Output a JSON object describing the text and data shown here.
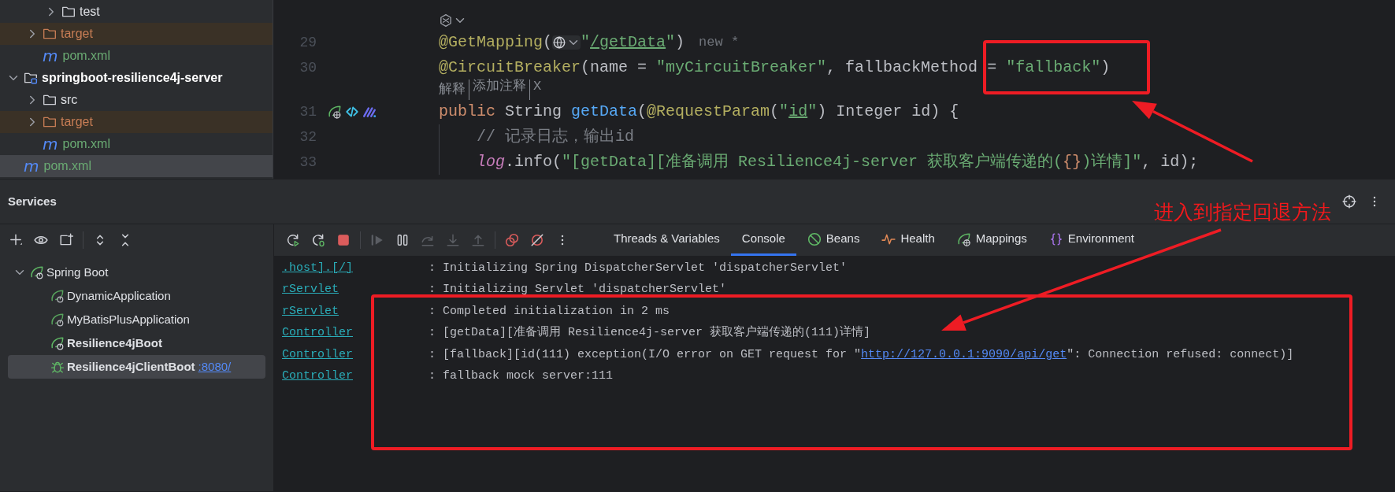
{
  "project_tree": [
    {
      "children": [
        {
          "children": [
            {
              "label": "test",
              "kind": "folder",
              "expanded": false,
              "selected": false
            }
          ]
        },
        {
          "label": "target",
          "kind": "excluded-folder",
          "expanded": false,
          "selected": false
        },
        {
          "label": "pom.xml",
          "kind": "maven",
          "icon_text": "m",
          "selected": false
        }
      ]
    },
    {
      "label": "springboot-resilience4j-server",
      "kind": "module",
      "expanded": true,
      "selected": false,
      "children": [
        {
          "label": "src",
          "kind": "folder",
          "expanded": false,
          "selected": false
        },
        {
          "label": "target",
          "kind": "excluded-folder",
          "expanded": false,
          "selected": false
        },
        {
          "label": "pom.xml",
          "kind": "maven",
          "icon_text": "m",
          "selected": false
        }
      ]
    },
    {
      "label": "pom.xml",
      "kind": "maven",
      "icon_text": "m",
      "selected": true
    }
  ],
  "editor": {
    "lines": [
      {
        "kind": "inlay"
      },
      {
        "kind": "code",
        "number": "29",
        "hint": "new *",
        "tokens": [
          {
            "kind": "annotation",
            "text": "@GetMapping"
          },
          {
            "kind": "plain",
            "text": "("
          },
          {
            "kind": "globe-inlay"
          },
          {
            "kind": "string",
            "text": "\""
          },
          {
            "kind": "link-string",
            "text": "/getData"
          },
          {
            "kind": "string",
            "text": "\""
          },
          {
            "kind": "plain",
            "text": ")"
          }
        ]
      },
      {
        "kind": "code",
        "number": "30",
        "tokens": [
          {
            "kind": "annotation",
            "text": "@CircuitBreaker"
          },
          {
            "kind": "plain",
            "text": "(name = "
          },
          {
            "kind": "string",
            "text": "\"myCircuitBreaker\""
          },
          {
            "kind": "plain",
            "text": ", fallbackMethod = "
          },
          {
            "kind": "string",
            "text": "\"fallback\""
          },
          {
            "kind": "plain",
            "text": ")"
          }
        ]
      },
      {
        "kind": "actions",
        "actions": [
          "解释",
          "添加注释",
          "X"
        ]
      },
      {
        "kind": "code",
        "number": "31",
        "gutter_icons": [
          {
            "kind": "endpoint"
          },
          {
            "kind": "navigate"
          },
          {
            "kind": "ai"
          }
        ],
        "tokens": [
          {
            "kind": "keyword",
            "text": "public "
          },
          {
            "kind": "plain",
            "text": "String "
          },
          {
            "kind": "method",
            "text": "getData"
          },
          {
            "kind": "plain",
            "text": "("
          },
          {
            "kind": "annotation",
            "text": "@RequestParam"
          },
          {
            "kind": "plain",
            "text": "("
          },
          {
            "kind": "string",
            "text": "\""
          },
          {
            "kind": "link-string",
            "text": "id"
          },
          {
            "kind": "string",
            "text": "\""
          },
          {
            "kind": "plain",
            "text": ") Integer id) {"
          }
        ]
      },
      {
        "kind": "code",
        "number": "32",
        "indented": true,
        "tokens": [
          {
            "kind": "comment",
            "text": "// 记录日志，输出id"
          }
        ]
      },
      {
        "kind": "code",
        "number": "33",
        "indented": true,
        "tokens": [
          {
            "kind": "field",
            "text": "log"
          },
          {
            "kind": "plain",
            "text": ".info("
          },
          {
            "kind": "string",
            "text": "\"[getData][准备调用 Resilience4j-server 获取客户端传递的("
          },
          {
            "kind": "placeholder",
            "text": "{}"
          },
          {
            "kind": "string",
            "text": ")详情]\""
          },
          {
            "kind": "plain",
            "text": ", id);"
          }
        ]
      }
    ]
  },
  "services": {
    "title": "Services",
    "header_icons": [
      {
        "kind": "crosshair"
      },
      {
        "kind": "more"
      }
    ],
    "toolbar": [
      {
        "kind": "add"
      },
      {
        "kind": "eye"
      },
      {
        "kind": "new-group"
      },
      {
        "kind": "separator"
      },
      {
        "kind": "expand"
      },
      {
        "kind": "collapse"
      }
    ],
    "tree": [
      {
        "label": "Spring Boot",
        "kind": "group",
        "expanded": true,
        "selected": false,
        "children": [
          {
            "label": "DynamicApplication",
            "kind": "app",
            "running": false,
            "selected": false
          },
          {
            "label": "MyBatisPlusApplication",
            "kind": "app",
            "running": false,
            "selected": false
          },
          {
            "label": "Resilience4jBoot",
            "kind": "app",
            "running": true,
            "selected": false
          },
          {
            "label": "Resilience4jClientBoot",
            "kind": "debug",
            "running": true,
            "selected": true,
            "port": ":8080/"
          }
        ]
      }
    ],
    "run_toolbar": [
      {
        "kind": "rerun",
        "disabled": false
      },
      {
        "kind": "rerun-debug",
        "disabled": false
      },
      {
        "kind": "stop",
        "disabled": false
      },
      {
        "kind": "separator"
      },
      {
        "kind": "resume",
        "disabled": true
      },
      {
        "kind": "pause",
        "disabled": false
      },
      {
        "kind": "step-over",
        "disabled": true
      },
      {
        "kind": "step-into",
        "disabled": true
      },
      {
        "kind": "step-out",
        "disabled": true
      },
      {
        "kind": "separator"
      },
      {
        "kind": "breakpoints",
        "disabled": false
      },
      {
        "kind": "mute-breakpoints",
        "disabled": false
      },
      {
        "kind": "more",
        "disabled": false
      }
    ],
    "tabs": [
      {
        "label": "Threads & Variables",
        "kind": "plain",
        "selected": false
      },
      {
        "label": "Console",
        "kind": "plain",
        "selected": true
      },
      {
        "label": "Beans",
        "kind": "beans",
        "selected": false
      },
      {
        "label": "Health",
        "kind": "health",
        "selected": false
      },
      {
        "label": "Mappings",
        "kind": "mappings",
        "selected": false
      },
      {
        "label": "Environment",
        "kind": "environment",
        "selected": false
      }
    ],
    "console": [
      {
        "source": ".host].[/]",
        "message": ": Initializing Spring DispatcherServlet 'dispatcherServlet'"
      },
      {
        "source": "rServlet",
        "message": ": Initializing Servlet 'dispatcherServlet'"
      },
      {
        "source": "rServlet",
        "message": ": Completed initialization in 2 ms"
      },
      {
        "source": "Controller",
        "message": ": [getData][准备调用 Resilience4j-server 获取客户端传递的(111)详情]"
      },
      {
        "source": "Controller",
        "message": ": [fallback][id(111) exception(I/O error on GET request for \"",
        "link": "http://127.0.0.1:9090/api/get",
        "message_after": "\": Connection refused: connect)]"
      },
      {
        "source": "Controller",
        "message": ": fallback mock server:111"
      }
    ]
  },
  "annotations": [
    {
      "kind": "box"
    },
    {
      "kind": "arrow"
    },
    {
      "kind": "label",
      "text": "进入到指定回退方法"
    },
    {
      "kind": "arrow"
    },
    {
      "kind": "box"
    }
  ]
}
